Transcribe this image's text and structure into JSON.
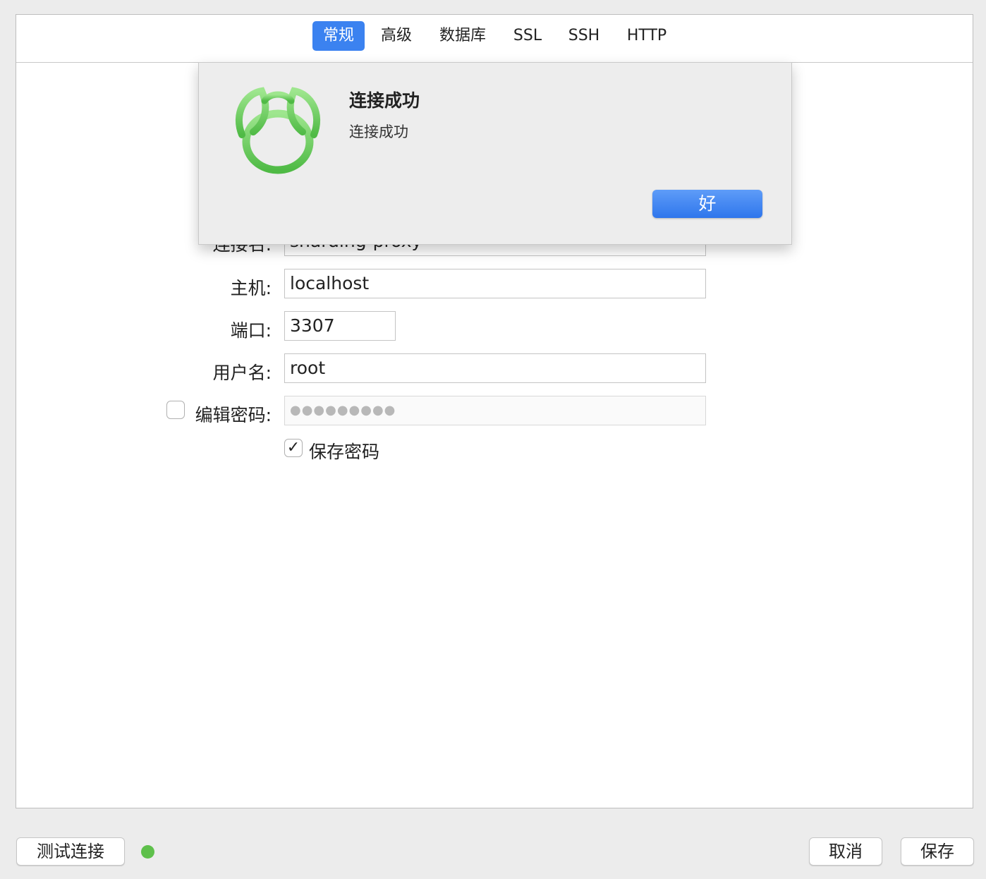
{
  "tabs": [
    {
      "label": "常规",
      "active": true
    },
    {
      "label": "高级",
      "active": false
    },
    {
      "label": "数据库",
      "active": false
    },
    {
      "label": "SSL",
      "active": false
    },
    {
      "label": "SSH",
      "active": false
    },
    {
      "label": "HTTP",
      "active": false
    }
  ],
  "form": {
    "connection_name": {
      "label": "连接名:",
      "value": "sharding-proxy"
    },
    "host": {
      "label": "主机:",
      "value": "localhost"
    },
    "port": {
      "label": "端口:",
      "value": "3307"
    },
    "username": {
      "label": "用户名:",
      "value": "root"
    },
    "edit_password": {
      "label": "编辑密码:",
      "checked": false,
      "masked_value": "●●●●●●●●●"
    },
    "save_password": {
      "label": "保存密码",
      "checked": true,
      "check_glyph": "✓"
    }
  },
  "footer": {
    "test_button": "测试连接",
    "status_color": "#5ec04b",
    "cancel_button": "取消",
    "save_button": "保存"
  },
  "alert": {
    "icon": "navicat-logo-icon",
    "title": "连接成功",
    "message": "连接成功",
    "ok_button": "好",
    "accent_color": "#3b82f0"
  }
}
